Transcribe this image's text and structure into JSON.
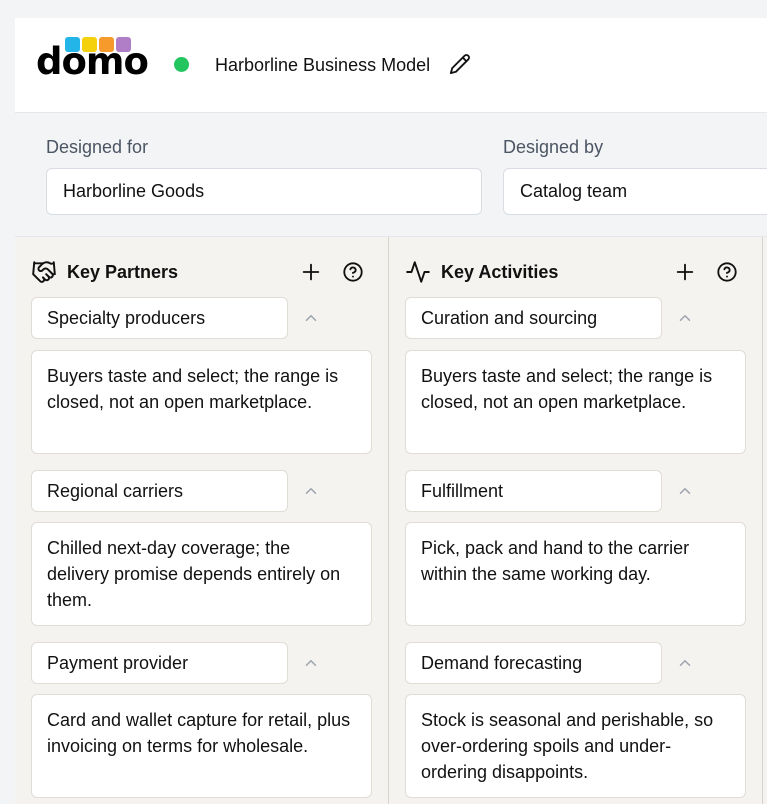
{
  "header": {
    "logo_text": "domo",
    "logo_colors": [
      "#23b5e8",
      "#f5d10b",
      "#f59a2b",
      "#b07ec6"
    ],
    "status_color": "#22c55e",
    "title": "Harborline Business Model"
  },
  "meta": {
    "designed_for_label": "Designed for",
    "designed_for_value": "Harborline Goods",
    "designed_by_label": "Designed by",
    "designed_by_value": "Catalog team"
  },
  "columns": [
    {
      "title": "Key Partners",
      "icon": "handshake-icon",
      "items": [
        {
          "title": "Specialty producers",
          "body": "Buyers taste and select; the range is closed, not an open marketplace."
        },
        {
          "title": "Regional carriers",
          "body": "Chilled next-day coverage; the delivery promise depends entirely on them."
        },
        {
          "title": "Payment provider",
          "body": "Card and wallet capture for retail, plus invoicing on terms for wholesale."
        }
      ]
    },
    {
      "title": "Key Activities",
      "icon": "activity-icon",
      "items": [
        {
          "title": "Curation and sourcing",
          "body": "Buyers taste and select; the range is closed, not an open marketplace."
        },
        {
          "title": "Fulfillment",
          "body": "Pick, pack and hand to the carrier within the same working day."
        },
        {
          "title": "Demand forecasting",
          "body": "Stock is seasonal and perishable, so over-ordering spoils and under-ordering disappoints."
        }
      ]
    }
  ]
}
